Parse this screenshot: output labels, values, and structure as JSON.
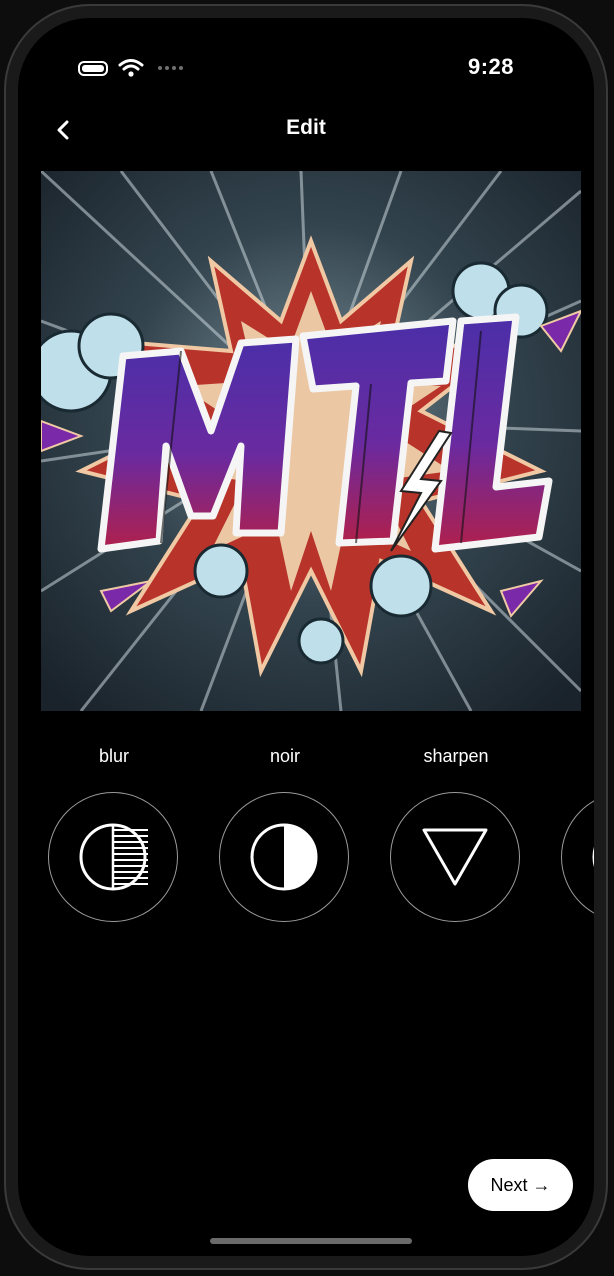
{
  "status_bar": {
    "time": "9:28"
  },
  "nav": {
    "title": "Edit",
    "back_icon": "chevron-left-icon"
  },
  "artwork": {
    "text": "MTL",
    "colors": {
      "letters": "#5a2a9c",
      "letter_fill_bottom": "#a01c4c",
      "burst": "#b8342a",
      "background": "#1d2830"
    }
  },
  "filters": [
    {
      "label": "blur",
      "icon": "half-striped-circle-icon"
    },
    {
      "label": "noir",
      "icon": "half-filled-circle-icon"
    },
    {
      "label": "sharpen",
      "icon": "triangle-down-icon"
    },
    {
      "label": "",
      "icon": "partial-circle-icon"
    }
  ],
  "actions": {
    "next_label": "Next →"
  }
}
